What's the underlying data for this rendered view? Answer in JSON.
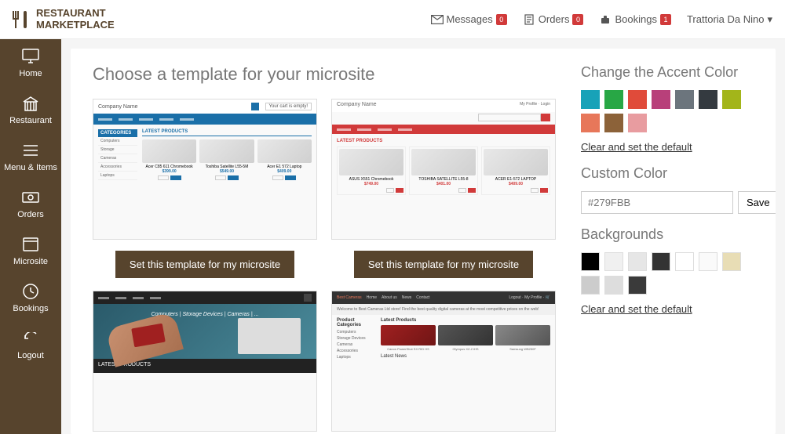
{
  "brand": {
    "line1": "RESTAURANT",
    "line2": "MARKETPLACE"
  },
  "header": {
    "messages_label": "Messages",
    "messages_badge": "0",
    "orders_label": "Orders",
    "orders_badge": "0",
    "bookings_label": "Bookings",
    "bookings_badge": "1",
    "user_name": "Trattoria Da Nino"
  },
  "sidebar": {
    "home": "Home",
    "restaurant": "Restaurant",
    "menu": "Menu & Items",
    "orders": "Orders",
    "microsite": "Microsite",
    "bookings": "Bookings",
    "logout": "Logout"
  },
  "main": {
    "title": "Choose a template for your microsite",
    "set_template_btn": "Set this template for my microsite",
    "tpl_company": "Company Name",
    "tpl_categories": "CATEGORIES",
    "tpl_latest": "LATEST PRODUCTS",
    "tpl_cart": "Your cart is empty!",
    "tpl1_prices": [
      "$399.00",
      "$549.00",
      "$409.00"
    ],
    "tpl2_prices": [
      "$749.00",
      "$401.00",
      "$409.00"
    ],
    "tpl3_links": "Computers  |  Storage Devices  |  Cameras  |  ...",
    "tpl4_bannertxt": "Welcome to Best Cameras Ltd store! Find the best quality digital cameras at the most competitive prices on the web!",
    "tpl4_prodcats": "Product Categories",
    "tpl4_latest": "Latest Products",
    "tpl4_news": "Latest News",
    "tpl4_brand": "Best Cameras"
  },
  "side": {
    "accent_title": "Change the Accent Color",
    "clear_default": "Clear and set the default",
    "custom_title": "Custom Color",
    "custom_placeholder": "#279FBB",
    "save": "Save",
    "bg_title": "Backgrounds",
    "accent_colors": [
      "#18a2b8",
      "#28a745",
      "#e04b3a",
      "#b8407a",
      "#6c757d",
      "#343a40",
      "#a3b51a",
      "#e7775a",
      "#8c6239",
      "#e89ca0"
    ],
    "bg_colors": [
      "#000000",
      "#f0f0f0",
      "#e6e6e6",
      "#333333",
      "#ffffff",
      "#fafafa",
      "#e8ddb5",
      "#cccccc",
      "#dddddd",
      "#3a3a3a"
    ]
  }
}
